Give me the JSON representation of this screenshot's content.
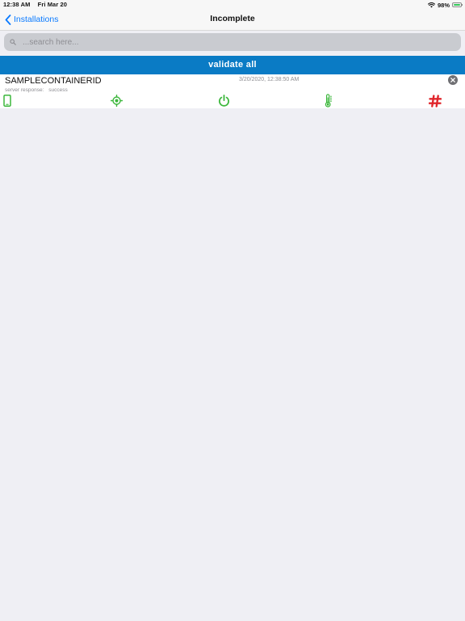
{
  "status_bar": {
    "time": "12:38 AM",
    "date": "Fri Mar 20",
    "battery": "98%",
    "battery_level": 0.98
  },
  "nav": {
    "back_label": "Installations",
    "title": "Incomplete"
  },
  "search": {
    "placeholder": "...search here...",
    "value": ""
  },
  "validate_all_label": "validate all",
  "rows": [
    {
      "title": "SAMPLECONTAINERID",
      "date": "3/20/2020, 12:38:50 AM",
      "response_label": "server response:",
      "response_value": "success",
      "icons": [
        {
          "name": "phone-icon",
          "color": "#3cb73c"
        },
        {
          "name": "location-target-icon",
          "color": "#3cb73c"
        },
        {
          "name": "power-icon",
          "color": "#3cb73c"
        },
        {
          "name": "thermometer-icon",
          "color": "#3cb73c"
        },
        {
          "name": "hashtag-icon",
          "color": "#e0262b"
        }
      ]
    }
  ],
  "colors": {
    "accent": "#0a7aff",
    "validate_bar": "#0a7bc5",
    "ok": "#3cb73c",
    "error": "#e0262b"
  }
}
